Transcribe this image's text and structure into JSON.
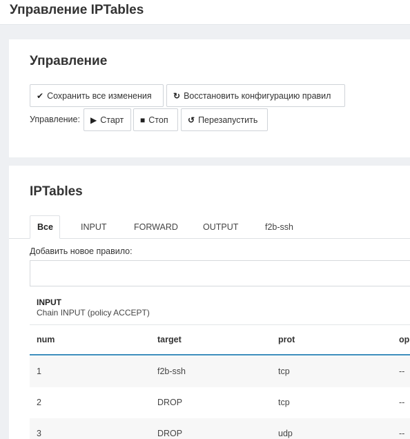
{
  "page": {
    "title": "Управление IPTables"
  },
  "management": {
    "heading": "Управление",
    "save_all": "Сохранить все изменения",
    "restore_config": "Восстановить конфигурацию правил",
    "control_label": "Управление:",
    "start": "Старт",
    "stop": "Стоп",
    "restart": "Перезапустить"
  },
  "iptables": {
    "heading": "IPTables",
    "tabs": [
      "Все",
      "INPUT",
      "FORWARD",
      "OUTPUT",
      "f2b-ssh"
    ],
    "active_tab": "Все",
    "add_rule_label": "Добавить новое правило:",
    "add_rule_value": "",
    "chain": {
      "name": "INPUT",
      "policy": "Chain INPUT (policy ACCEPT)"
    },
    "columns": [
      "num",
      "target",
      "prot",
      "op"
    ],
    "rows": [
      {
        "num": "1",
        "target": "f2b-ssh",
        "prot": "tcp",
        "opt": "--"
      },
      {
        "num": "2",
        "target": "DROP",
        "prot": "tcp",
        "opt": "--"
      },
      {
        "num": "3",
        "target": "DROP",
        "prot": "udp",
        "opt": "--"
      }
    ]
  },
  "colors": {
    "accent": "#3c8dbc",
    "background": "#eef0f3"
  }
}
